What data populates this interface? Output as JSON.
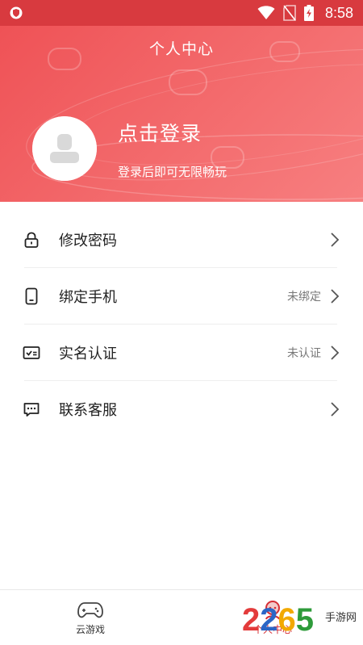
{
  "status_bar": {
    "time": "8:58"
  },
  "header": {
    "title": "个人中心",
    "login_title": "点击登录",
    "login_subtitle": "登录后即可无限畅玩"
  },
  "menu": {
    "items": [
      {
        "label": "修改密码",
        "status": "",
        "icon": "lock-icon"
      },
      {
        "label": "绑定手机",
        "status": "未绑定",
        "icon": "phone-icon"
      },
      {
        "label": "实名认证",
        "status": "未认证",
        "icon": "id-card-icon"
      },
      {
        "label": "联系客服",
        "status": "",
        "icon": "chat-icon"
      }
    ]
  },
  "bottom_nav": {
    "items": [
      {
        "label": "云游戏",
        "icon": "gamepad-icon",
        "active": false
      },
      {
        "label": "个人中心",
        "icon": "person-icon",
        "active": true
      }
    ]
  },
  "watermark": {
    "digits": "2265",
    "text": "手游网"
  },
  "colors": {
    "accent": "#d62e35",
    "header_start": "#ef5256",
    "header_end": "#f77f80"
  }
}
